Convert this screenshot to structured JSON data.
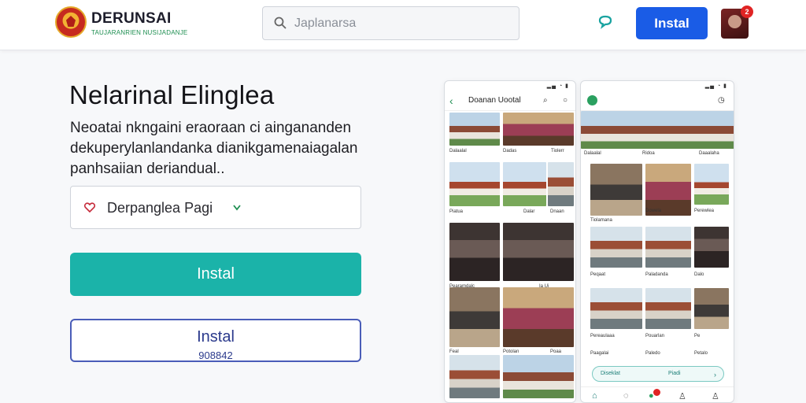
{
  "header": {
    "brand_title": "DERUNSAI",
    "brand_subtitle": "TAUJARANRIEN NUSIJADANJE",
    "search_placeholder": "Japlanarsa",
    "install_label": "Instal",
    "notification_count": "2"
  },
  "hero": {
    "headline": "Nelarinal Elinglea",
    "description": "Neoatai nkngaini eraoraan ci aingananden dekuperylanlandanka dianikgamenaiagalan panhsaiian deriandual..",
    "select_label": "Derpanglea Pagi",
    "primary_button": "Instal",
    "secondary_button": "Instal",
    "secondary_sub": "908842"
  },
  "phone_left": {
    "title": "Doanan Uootal",
    "captions": [
      "Dalaalal",
      "Dadas",
      "Tiolerr",
      "Piatua",
      "Dalar",
      "Dnaan",
      "Pearamdalc",
      "Ia Ui",
      "Feal",
      "Potolan",
      "Poaa"
    ]
  },
  "phone_right": {
    "captions": [
      "Dalaalal",
      "Ridoa",
      "Daaalaha",
      "Tiolamana",
      "Dowela",
      "Perewlea",
      "Peqaat",
      "Paladanda",
      "Dalo",
      "Pereaulaaa",
      "Pouarlan",
      "Pe",
      "Paagalai",
      "Paledo",
      "Petalo"
    ],
    "pill_left": "Diseklat",
    "pill_right": "Piadi",
    "nav_badge": "1"
  },
  "colors": {
    "brand_blue": "#1a5ce6",
    "teal": "#1bb3a9",
    "outline_blue": "#4a5db8"
  }
}
